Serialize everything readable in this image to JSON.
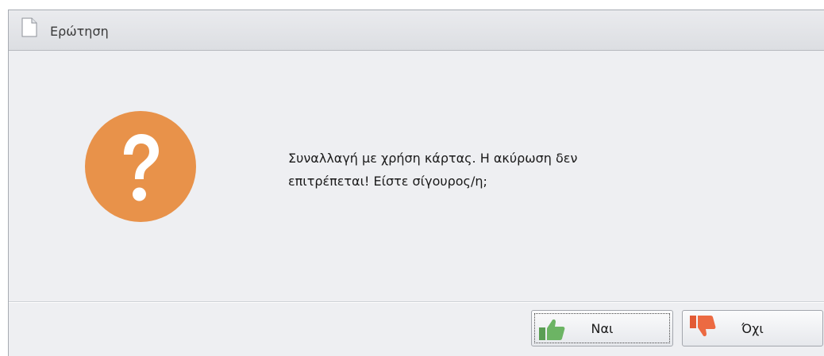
{
  "dialog": {
    "title": "Ερώτηση",
    "title_icon": "document-icon",
    "icon": "question-icon",
    "icon_color": "#e8924a",
    "message": "Συναλλαγή με χρήση κάρτας. Η ακύρωση δεν\nεπιτρέπεται! Είστε σίγουρος/η;"
  },
  "buttons": {
    "yes_label": "Ναι",
    "yes_icon": "thumbs-up-icon",
    "no_label": "Όχι",
    "no_icon": "thumbs-down-icon"
  }
}
